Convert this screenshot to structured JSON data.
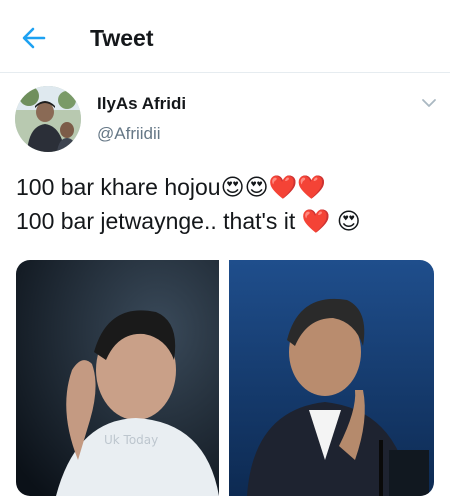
{
  "header": {
    "title": "Tweet",
    "back_icon": "arrow-left-icon",
    "accent": "#1da1f2"
  },
  "author": {
    "name": "IlyAs Afridi",
    "handle": "@Afriidii"
  },
  "tweet": {
    "line1": "100 bar khare hojou😍😍❤️❤️",
    "line2": "100 bar jetwaynge.. that's it ❤️ 😍"
  },
  "media": {
    "watermark": "Uk Today"
  },
  "colors": {
    "text": "#14171a",
    "secondary": "#657786",
    "divider": "#e6ecf0"
  }
}
